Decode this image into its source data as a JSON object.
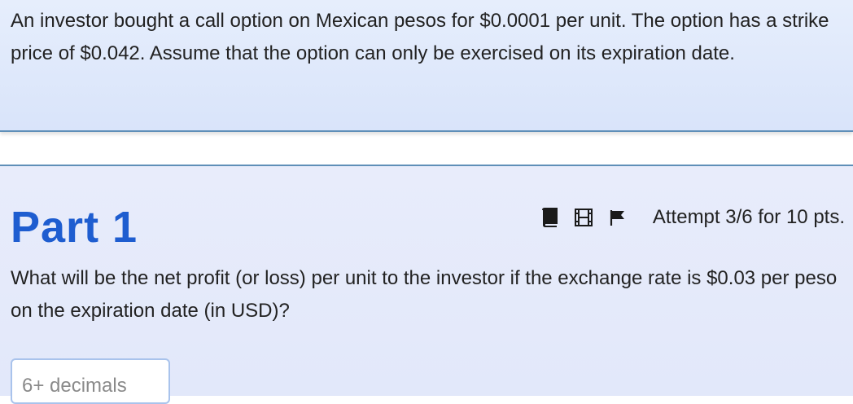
{
  "intro": {
    "text": "An investor bought a call option on Mexican pesos for $0.0001 per unit. The option has a strike price of $0.042. Assume that the option can only be exercised on its expiration date."
  },
  "part": {
    "title": "Part 1",
    "toolbar": {
      "icons": [
        "book-icon",
        "film-icon",
        "flag-icon"
      ],
      "attempt_text": "Attempt 3/6 for 10 pts."
    },
    "question": "What will be the net profit (or loss) per unit to the investor if the exchange rate is $0.03 per peso on the expiration date (in USD)?",
    "answer": {
      "value": "",
      "placeholder": "6+ decimals"
    }
  }
}
